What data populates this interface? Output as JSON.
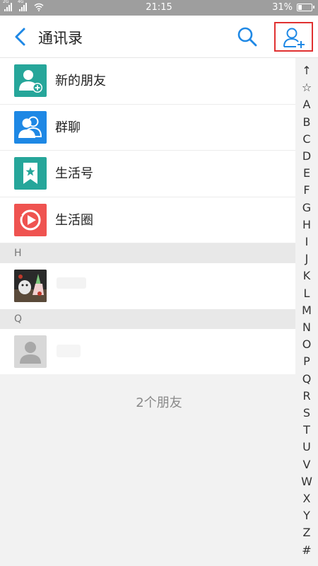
{
  "status_bar": {
    "network_label_1": "2G",
    "network_label_2": "4G",
    "time": "21:15",
    "battery_percent": "31%",
    "battery_level": 0.31
  },
  "header": {
    "title": "通讯录",
    "back_icon": "chevron-left-icon",
    "search_icon": "search-icon",
    "add_icon": "add-person-icon",
    "accent_color": "#1e88e5",
    "highlight_color": "#e03131"
  },
  "menu": [
    {
      "label": "新的朋友",
      "icon": "new-friend-icon",
      "color": "#26a69a"
    },
    {
      "label": "群聊",
      "icon": "group-chat-icon",
      "color": "#1e88e5"
    },
    {
      "label": "生活号",
      "icon": "life-account-icon",
      "color": "#26a69a"
    },
    {
      "label": "生活圈",
      "icon": "life-circle-icon",
      "color": "#ef5350"
    }
  ],
  "sections": [
    {
      "letter": "H"
    },
    {
      "letter": "Q"
    }
  ],
  "footer": {
    "count_text": "2个朋友"
  },
  "index": [
    "↑",
    "☆",
    "A",
    "B",
    "C",
    "D",
    "E",
    "F",
    "G",
    "H",
    "I",
    "J",
    "K",
    "L",
    "M",
    "N",
    "O",
    "P",
    "Q",
    "R",
    "S",
    "T",
    "U",
    "V",
    "W",
    "X",
    "Y",
    "Z",
    "#"
  ]
}
